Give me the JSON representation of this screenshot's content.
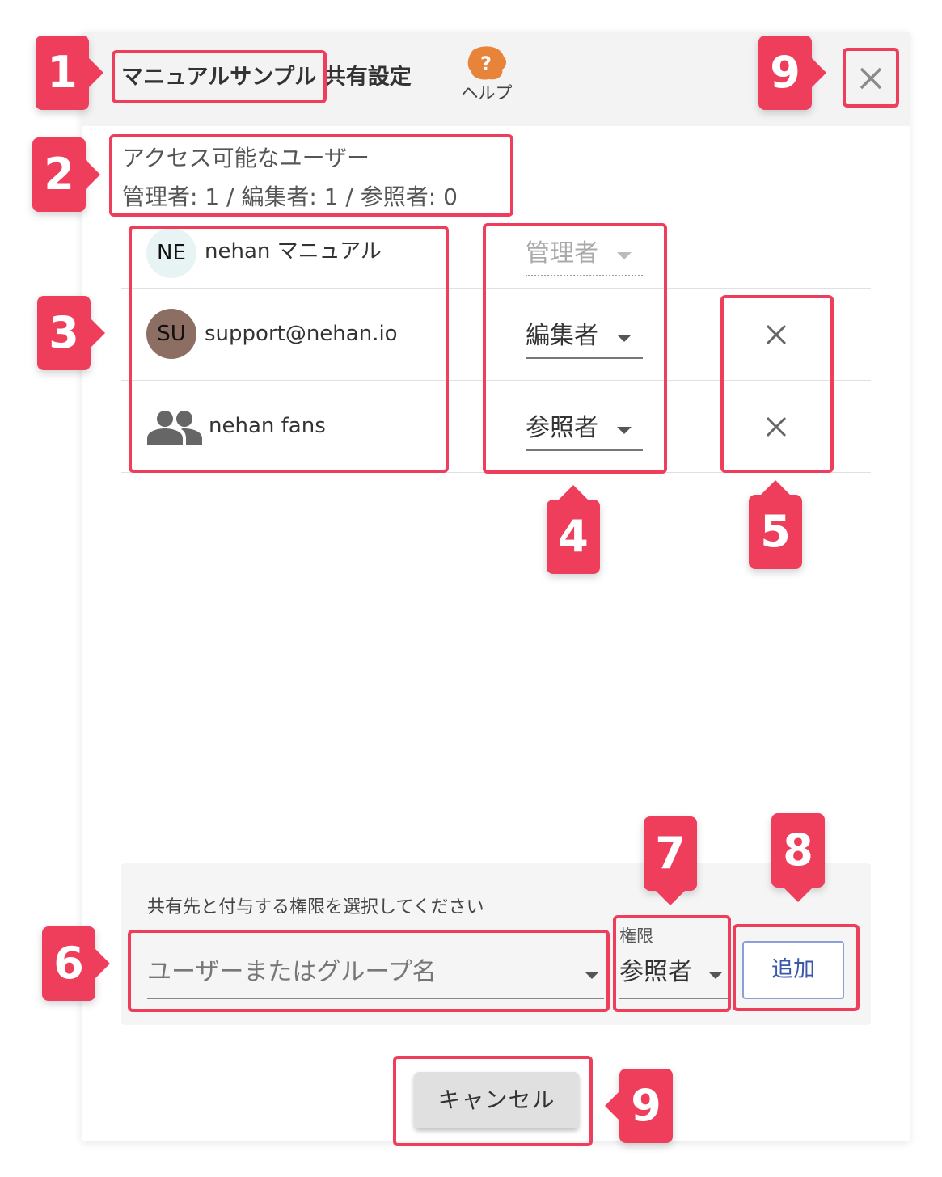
{
  "dialog": {
    "title": "マニュアルサンプル 共有設定",
    "help_label": "ヘルプ",
    "icons": {
      "help": "help-bubble-icon",
      "close": "close-icon"
    }
  },
  "access": {
    "title": "アクセス可能なユーザー",
    "counts": "管理者: 1 / 編集者: 1 / 参照者: 0"
  },
  "members": [
    {
      "avatar": "NE",
      "avatar_color": "#e8f4f3",
      "name": "nehan マニュアル",
      "role": "管理者",
      "removable": false
    },
    {
      "avatar": "SU",
      "avatar_color": "#8d6e63",
      "name": "support@nehan.io",
      "role": "編集者",
      "removable": true
    },
    {
      "avatar_icon": "group-icon",
      "name": "nehan fans",
      "role": "参照者",
      "removable": true
    }
  ],
  "add_panel": {
    "instruction": "共有先と付与する権限を選択してください",
    "user_placeholder": "ユーザーまたはグループ名",
    "permission_label": "権限",
    "permission_value": "参照者",
    "add_label": "追加"
  },
  "footer": {
    "cancel_label": "キャンセル"
  },
  "annotations": {
    "color": "#ef3d5c",
    "badges": [
      "1",
      "2",
      "3",
      "4",
      "5",
      "6",
      "7",
      "8",
      "9",
      "9"
    ]
  }
}
